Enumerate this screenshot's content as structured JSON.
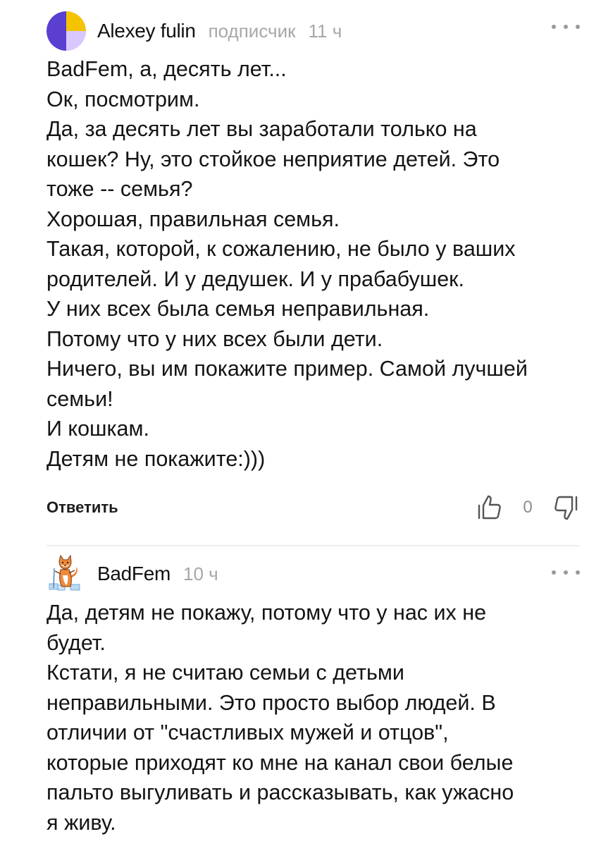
{
  "comments": [
    {
      "author": "Alexey fulin",
      "role": "подписчик",
      "time": "11 ч",
      "avatar_colors": [
        "#5a3fd0",
        "#f5c400",
        "#d9c8ff"
      ],
      "lines": [
        "BadFem, а, десять лет...",
        "Ок, посмотрим.",
        "Да, за десять лет вы заработали только на",
        "кошек? Ну, это стойкое неприятие детей. Это",
        "тоже -- семья?",
        "Хорошая, правильная семья.",
        "Такая, которой, к сожалению, не было у ваших",
        "родителей. И у дедушек. И у прабабушек.",
        "У них всех была семья неправильная.",
        "Потому что у них всех были дети.",
        "Ничего, вы им покажите пример. Самой лучшей",
        "семьи!",
        "И кошкам.",
        "Детям не покажите:)))"
      ],
      "reply_label": "Ответить",
      "likes": "0"
    },
    {
      "author": "BadFem",
      "time": "10 ч",
      "lines": [
        "Да, детям не покажу, потому что у нас их не",
        "будет.",
        "Кстати, я не считаю семьи с детьми",
        "неправильными. Это просто выбор людей. В",
        "отличии от \"счастливых мужей и отцов\",",
        "которые приходят ко мне на канал свои белые",
        "пальто выгуливать и рассказывать, как ужасно",
        "я живу."
      ]
    }
  ],
  "icons": {
    "more": "more-dots-icon",
    "like": "thumb-up-icon",
    "dislike": "thumb-down-icon"
  }
}
